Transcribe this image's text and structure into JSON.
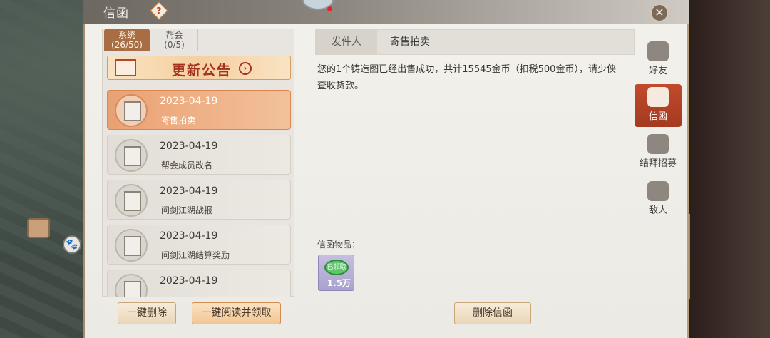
{
  "window": {
    "title": "信函",
    "help_glyph": "?",
    "close_glyph": "✕"
  },
  "tabs": [
    {
      "label": "系统",
      "count": "(26/50)",
      "active": true
    },
    {
      "label": "帮会",
      "count": "(0/5)",
      "active": false
    }
  ],
  "announcement": {
    "label": "更新公告",
    "arrow": "›"
  },
  "mails": [
    {
      "date": "2023-04-19",
      "title": "寄售拍卖",
      "active": true
    },
    {
      "date": "2023-04-19",
      "title": "帮会成员改名",
      "active": false
    },
    {
      "date": "2023-04-19",
      "title": "问剑江湖战报",
      "active": false
    },
    {
      "date": "2023-04-19",
      "title": "问剑江湖结算奖励",
      "active": false
    },
    {
      "date": "2023-04-19",
      "title": "",
      "active": false
    }
  ],
  "detail": {
    "sender_label": "发件人",
    "sender_name": "寄售拍卖",
    "body": "您的1个铸造图已经出售成功，共计15545金币（扣税500金币），请少侠查收货款。",
    "attachments_label": "信函物品：",
    "attachment": {
      "icon_text": "已领取",
      "quantity": "1.5万"
    }
  },
  "buttons": {
    "delete_all": "一键删除",
    "read_all": "一键阅读并领取",
    "delete_mail": "删除信函"
  },
  "side_nav": [
    {
      "label": "好友",
      "icon": "friends-icon",
      "active": false
    },
    {
      "label": "信函",
      "icon": "mail-icon",
      "active": true
    },
    {
      "label": "结拜招募",
      "icon": "sworn-icon",
      "active": false
    },
    {
      "label": "敌人",
      "icon": "enemy-icon",
      "active": false
    }
  ],
  "colors": {
    "accent": "#a86d43",
    "active_item": "#e9a173",
    "nav_active": "#c24a2b"
  }
}
